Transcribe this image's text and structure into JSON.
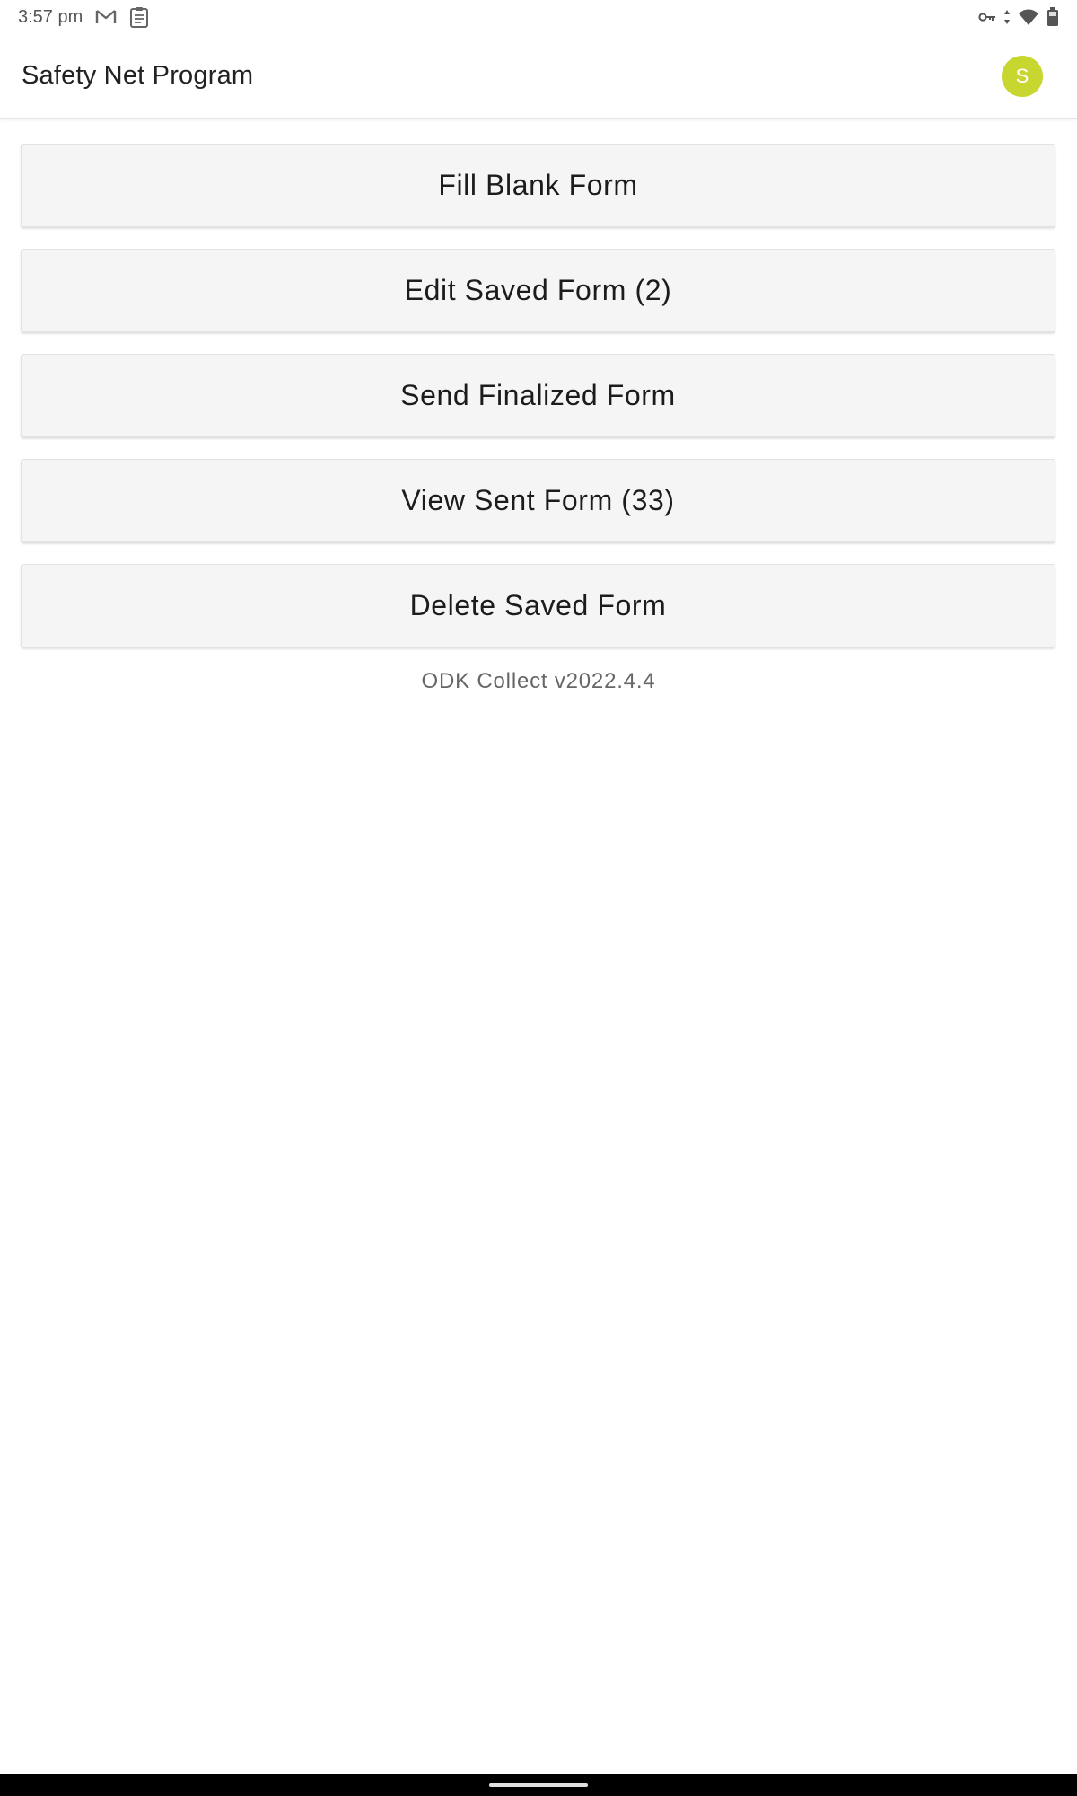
{
  "status_bar": {
    "time": "3:57 pm",
    "left_icons": [
      "gmail-icon",
      "clipboard-icon"
    ],
    "right_icons": [
      "vpn-key-icon",
      "wifi-icon",
      "battery-icon"
    ]
  },
  "app_bar": {
    "title": "Safety Net Program",
    "avatar_letter": "S",
    "avatar_color": "#c8d630"
  },
  "menu": {
    "buttons": [
      {
        "label": "Fill Blank Form"
      },
      {
        "label": "Edit Saved Form (2)"
      },
      {
        "label": "Send Finalized Form"
      },
      {
        "label": "View Sent Form (33)"
      },
      {
        "label": "Delete Saved Form"
      }
    ]
  },
  "footer": {
    "version": "ODK Collect v2022.4.4"
  }
}
